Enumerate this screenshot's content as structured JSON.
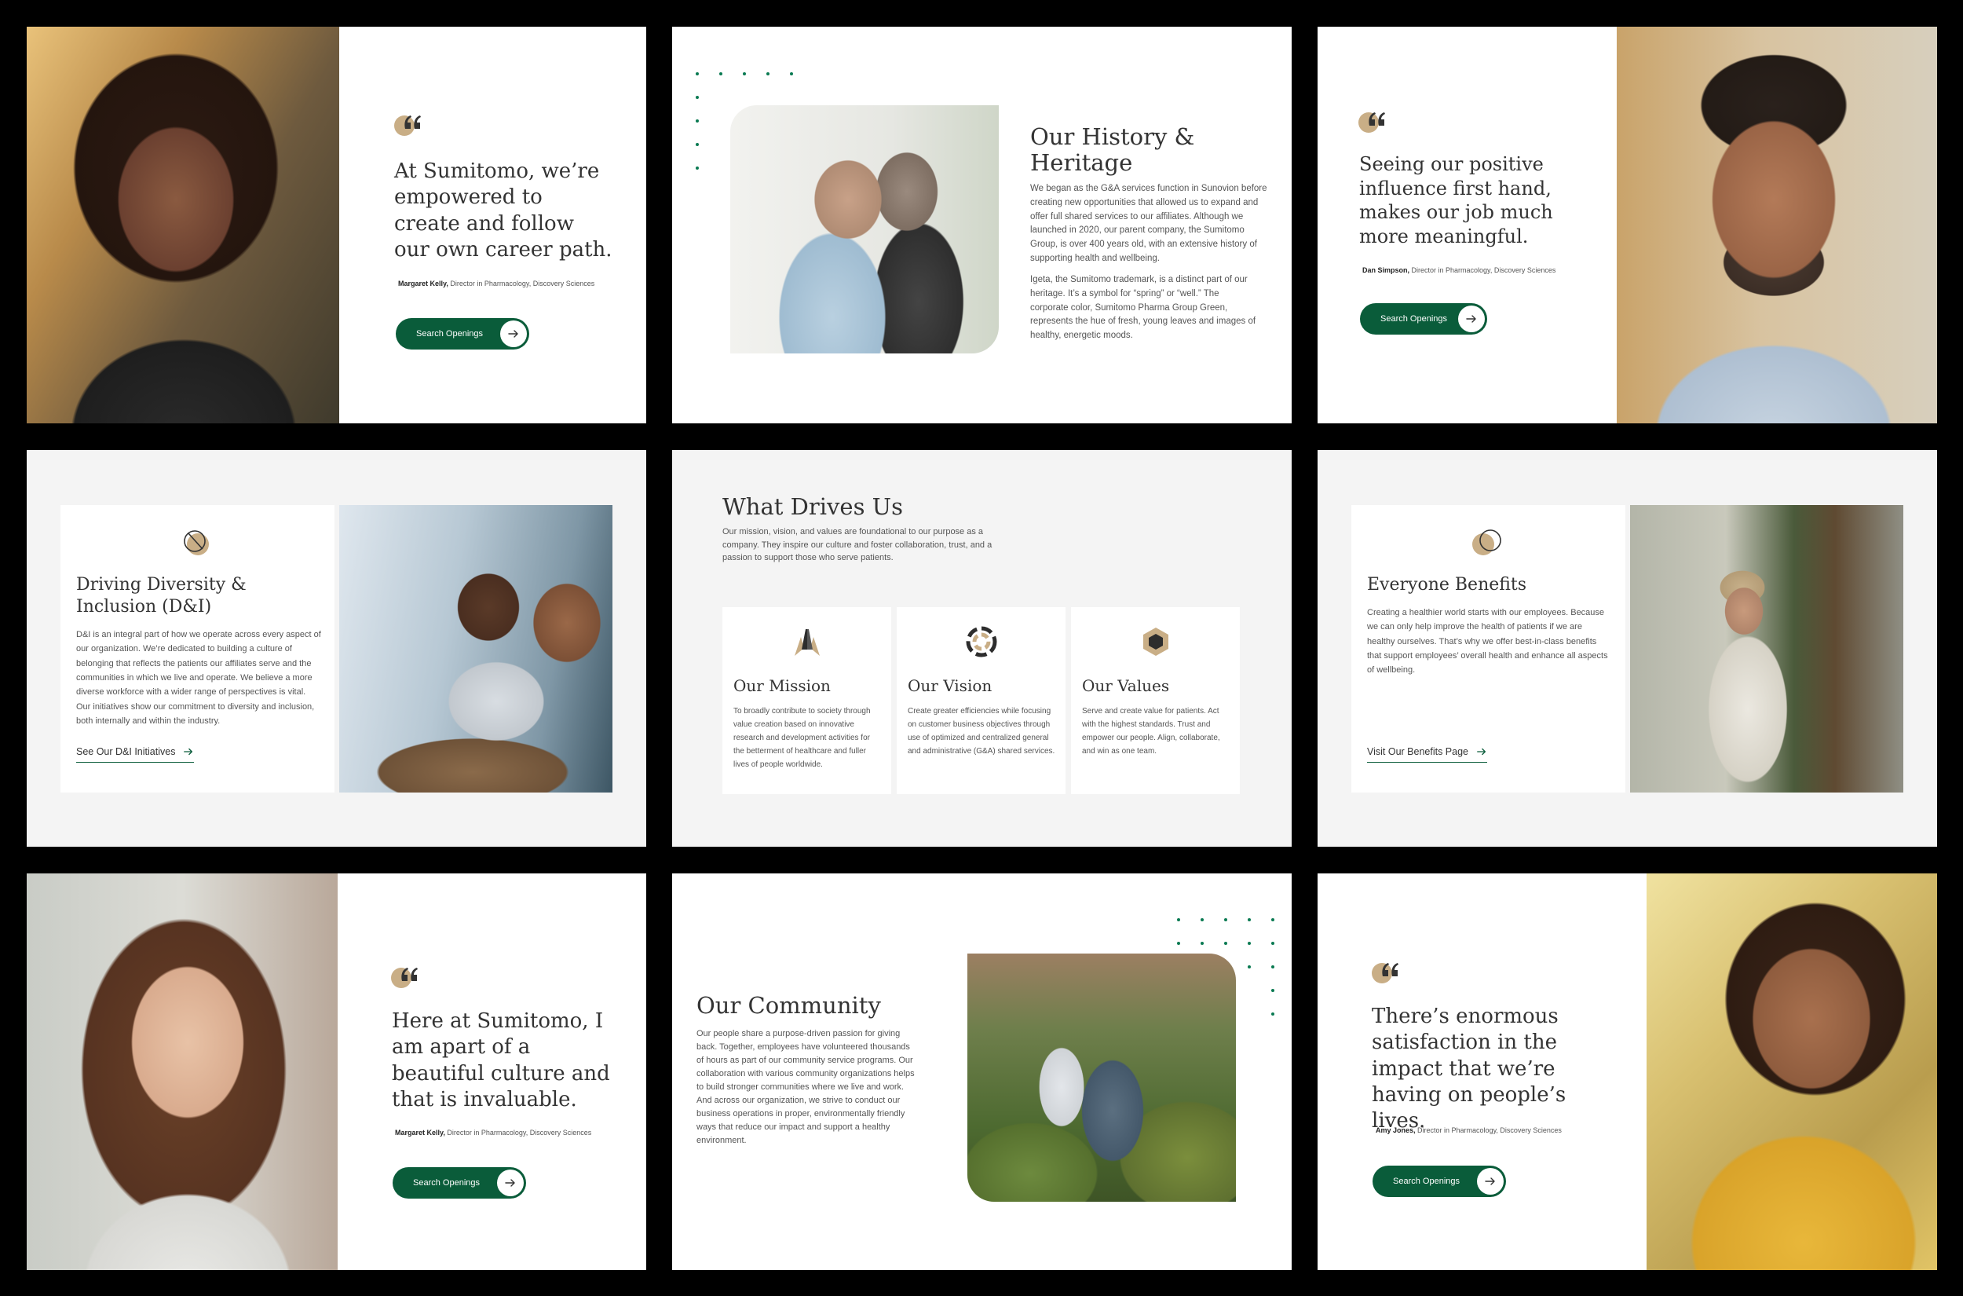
{
  "quotes": [
    {
      "text": "At Sumitomo, we’re empowered to create and follow our own career path.",
      "name": "Margaret Kelly,",
      "role": " Director in Pharmacology, Discovery Sciences",
      "button": "Search Openings"
    },
    {
      "text": "Seeing our positive influence first hand, makes our job much more meaningful.",
      "name": "Dan Simpson,",
      "role": " Director in Pharmacology, Discovery Sciences",
      "button": "Search Openings"
    },
    {
      "text": "Here at Sumitomo, I am apart of a beautiful culture and that is invaluable.",
      "name": "Margaret Kelly,",
      "role": " Director in Pharmacology, Discovery Sciences",
      "button": "Search Openings"
    },
    {
      "text": "There’s enormous satisfaction in the impact that we’re having on people’s lives.",
      "name": "Amy Jones,",
      "role": " Director in Pharmacology, Discovery Sciences",
      "button": "Search Openings"
    }
  ],
  "history": {
    "title_line1": "Our History &",
    "title_line2": "Heritage",
    "p1": "We began as the G&A services function in Sunovion before creating new opportunities that allowed us to expand and offer full shared services to our affiliates. Although we launched in 2020, our parent company, the Sumitomo Group, is over 400 years old, with an extensive history of supporting health and wellbeing.",
    "p2": "Igeta, the Sumitomo trademark, is a distinct part of our heritage. It’s a symbol for “spring” or “well.” The corporate color, Sumitomo Pharma Group Green, represents the hue of fresh, young leaves and images of healthy, energetic moods."
  },
  "diversity": {
    "title_line1": "Driving Diversity &",
    "title_line2": "Inclusion (D&I)",
    "body": "D&I is an integral part of how we operate across every aspect of our organization. We’re dedicated to building a culture of belonging that reflects the patients our affiliates serve and the communities in which we live and operate. We believe a more diverse workforce with a wider range of perspectives is vital. Our initiatives show our commitment to diversity and inclusion, both internally and within the industry.",
    "link": "See Our D&I Initiatives"
  },
  "drives": {
    "title": "What Drives Us",
    "intro": "Our mission, vision, and values are foundational to our purpose as a company. They inspire our culture and foster collaboration, trust, and a passion to support those who serve patients.",
    "cards": [
      {
        "title": "Our Mission",
        "icon": "mission-icon",
        "body": "To broadly contribute to society through value creation based on innovative research and development activities for the betterment of healthcare and fuller lives of people worldwide."
      },
      {
        "title": "Our Vision",
        "icon": "vision-icon",
        "body": "Create greater efficiencies while focusing on customer business objectives through use of optimized and centralized general and administrative (G&A) shared services."
      },
      {
        "title": "Our Values",
        "icon": "values-icon",
        "body": "Serve and create value for patients. Act with the highest standards. Trust and empower our people. Align, collaborate, and win as one team."
      }
    ]
  },
  "benefits": {
    "title": "Everyone Benefits",
    "body": "Creating a healthier world starts with our employees. Because we can only help improve the health of patients if we are healthy ourselves. That’s why we offer best-in-class benefits that support employees’ overall health and enhance all aspects of wellbeing.",
    "link": "Visit Our Benefits Page"
  },
  "community": {
    "title": "Our Community",
    "body": "Our people share a purpose-driven passion for giving back. Together, employees have volunteered thousands of hours as part of our community service programs. Our collaboration with various community organizations helps to build stronger communities where we live and work. And across our organization, we strive to conduct our business operations in proper, environmentally friendly ways that reduce our impact and support a healthy environment."
  },
  "colors": {
    "brand_green": "#0a5c3a",
    "accent_tan": "#c9ae86",
    "dot_green": "#0a7a52"
  }
}
